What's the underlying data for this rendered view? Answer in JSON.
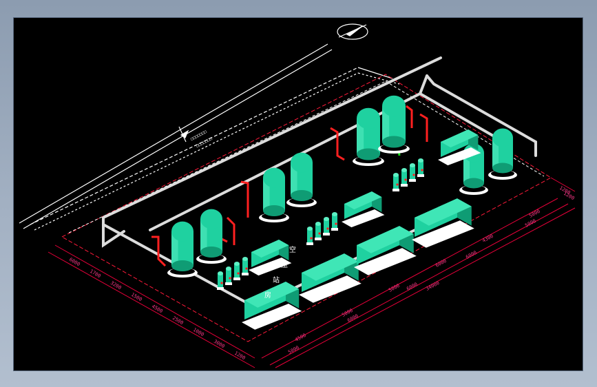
{
  "viewport": {
    "background": "#000000",
    "frame_color": "#9aa9bc"
  },
  "colors": {
    "vessel": "#1fd1a0",
    "vessel_dark": "#0f9c74",
    "dimension": "#e8003a",
    "dimension_text": "#ff3a8a",
    "pipe": "#d8d8d8",
    "red_pipe": "#ff2020",
    "base": "#ffffff",
    "grid": "#ffffff"
  },
  "dimensions": {
    "left_side": [
      "6000",
      "1700",
      "3200",
      "1500",
      "4500",
      "2500",
      "1000",
      "3000",
      "1200"
    ],
    "bottom_inner": [
      "4500",
      "5000",
      "5000",
      "6000",
      "4300",
      "5000"
    ],
    "bottom_outer": [
      "5000",
      "6000",
      "6000",
      "6000",
      "5000"
    ],
    "bottom_total": "34000",
    "right_end": [
      "1200",
      "1200"
    ]
  },
  "labels": {
    "room_marks": [
      "空",
      "压",
      "站",
      "房"
    ],
    "north_arrow": "north-arrow",
    "dim_text_small": "□□□□□□□"
  }
}
